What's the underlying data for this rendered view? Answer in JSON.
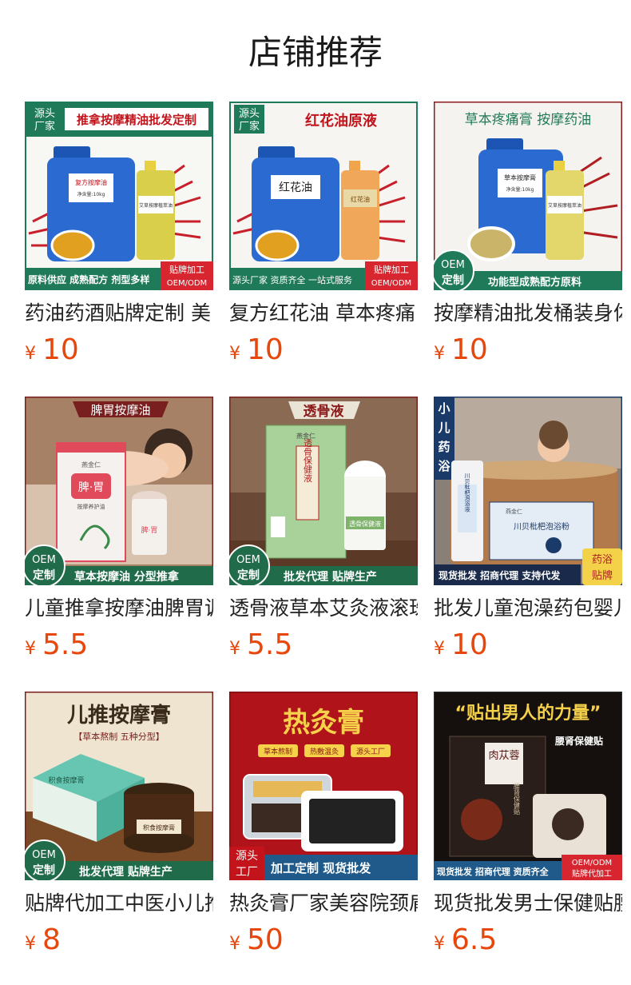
{
  "page": {
    "title": "店铺推荐"
  },
  "currency_symbol": "¥",
  "products": [
    {
      "title": "药油药酒贴牌定制 美",
      "price": "10",
      "image": {
        "banner": "推拿按摩精油批发定制",
        "corner_tag": [
          "源头",
          "厂家"
        ],
        "jug_label": "复方按摩油",
        "jug_sub": "净含量:10kg",
        "bottle_label": "艾草按摩植萃油",
        "footer": "原料供应 成熟配方 剂型多样",
        "badge": [
          "贴牌加工",
          "OEM/ODM"
        ]
      }
    },
    {
      "title": "复方红花油 草本疼痛",
      "price": "10",
      "image": {
        "banner": "红花油原液",
        "corner_tag": [
          "源头",
          "厂家"
        ],
        "jug_label": "红花油",
        "bottle_label": "红花油",
        "footer": "源头厂家 资质齐全 一站式服务",
        "badge": [
          "贴牌加工",
          "OEM/ODM"
        ]
      }
    },
    {
      "title": "按摩精油批发桶装身体",
      "price": "10",
      "image": {
        "banner": "草本疼痛膏 按摩药油",
        "jug_label": "草本按摩膏",
        "jug_sub": "净含量:10kg",
        "bottle_label": "艾草按摩植萃油",
        "oem": [
          "OEM",
          "定制"
        ],
        "footer": "功能型成熟配方原料"
      }
    },
    {
      "title": "儿童推拿按摩油脾胃调理",
      "price": "5.5",
      "image": {
        "banner": "脾胃按摩油",
        "box_brand": "燕金仁",
        "box_label": "脾·胃",
        "box_sub": "按摩养护油",
        "bottle_label": "脾·胃",
        "oem": [
          "OEM",
          "定制"
        ],
        "footer": "草本按摩油 分型推拿"
      }
    },
    {
      "title": "透骨液草本艾灸液滚珠",
      "price": "5.5",
      "image": {
        "banner": "透骨液",
        "box_brand": "燕金仁",
        "box_label": "透骨保健液",
        "bottle_label": "透骨保健液",
        "oem": [
          "OEM",
          "定制"
        ],
        "footer": "批发代理 贴牌生产"
      }
    },
    {
      "title": "批发儿童泡澡药包婴儿",
      "price": "10",
      "image": {
        "side_tag": [
          "小",
          "儿",
          "药",
          "浴"
        ],
        "box_brand": "燕金仁",
        "box_label": "川贝枇杷泡浴粉",
        "bottle_label": "川贝枇杷泡浴液",
        "footer": "现货批发 招商代理 支持代发",
        "badge": [
          "药浴",
          "贴牌"
        ]
      }
    },
    {
      "title": "贴牌代加工中医小儿推拿",
      "price": "8",
      "image": {
        "banner": "儿推按摩膏",
        "banner_sub": "【草本熬制 五种分型】",
        "box_label": "积食按摩膏",
        "jar_label": "积食按摩膏",
        "oem": [
          "OEM",
          "定制"
        ],
        "footer": "批发代理 贴牌生产"
      }
    },
    {
      "title": "热灸膏厂家美容院颈肩",
      "price": "50",
      "image": {
        "banner": "热灸膏",
        "chips": [
          "草本熬制",
          "热敷温灸",
          "源头工厂"
        ],
        "corner_tag": [
          "源头",
          "工厂"
        ],
        "footer": "加工定制 现货批发"
      }
    },
    {
      "title": "现货批发男士保健贴腰肾",
      "price": "6.5",
      "image": {
        "banner": "“贴出男人的力量”",
        "box_label": "肉苁蓉",
        "box_sub": "腰肾保健贴",
        "side_label": "腰肾保健贴",
        "footer": "现货批发 招商代理 资质齐全",
        "badge": [
          "OEM/ODM",
          "贴牌代加工"
        ]
      }
    }
  ]
}
